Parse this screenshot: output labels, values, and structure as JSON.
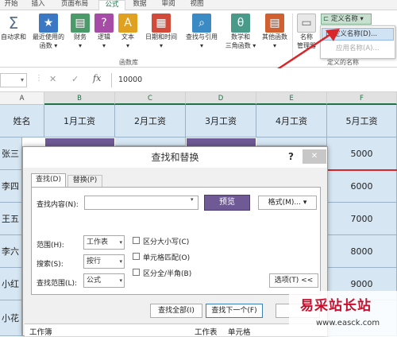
{
  "tabs": [
    "开始",
    "插入",
    "页面布局",
    "公式",
    "数据",
    "审阅",
    "视图"
  ],
  "ribbon": {
    "buttons": [
      {
        "label1": "自动求和",
        "label2": "",
        "color": "#5a6f8a",
        "glyph": "Σ"
      },
      {
        "label1": "最近使用的",
        "label2": "函数 ▾",
        "color": "#3a78c3",
        "glyph": "★"
      },
      {
        "label1": "财务",
        "label2": "▾",
        "color": "#4a9a6a",
        "glyph": "▤"
      },
      {
        "label1": "逻辑",
        "label2": "▾",
        "color": "#a64ca6",
        "glyph": "?"
      },
      {
        "label1": "文本",
        "label2": "▾",
        "color": "#e0a020",
        "glyph": "A"
      },
      {
        "label1": "日期和时间",
        "label2": "▾",
        "color": "#d24a3a",
        "glyph": "▦"
      },
      {
        "label1": "查找与引用",
        "label2": "▾",
        "color": "#3a8ac3",
        "glyph": "⌕"
      },
      {
        "label1": "数学和",
        "label2": "三角函数 ▾",
        "color": "#4a9a8a",
        "glyph": "θ"
      },
      {
        "label1": "其他函数",
        "label2": "▾",
        "color": "#d06030",
        "glyph": "▤"
      },
      {
        "label1": "名称",
        "label2": "管理器",
        "color": "#777777",
        "glyph": "▭"
      }
    ],
    "group_label": "函数库",
    "defined_names_label": "定义的名称",
    "dropdown": {
      "header": "定义名称 ▾",
      "item1": "定义名称(D)...",
      "item2": "应用名称(A)..."
    }
  },
  "formula_bar": {
    "value": "10000",
    "cancel": "✕",
    "enter": "✓",
    "fx": "fx"
  },
  "grid": {
    "columns": [
      "A",
      "B",
      "C",
      "D",
      "E",
      "F"
    ],
    "header_row": [
      "姓名",
      "1月工资",
      "2月工资",
      "3月工资",
      "4月工资",
      "5月工资"
    ],
    "names": [
      "张三",
      "李四",
      "王五",
      "李六",
      "小红",
      "小花"
    ],
    "col_f": [
      "5000",
      "6000",
      "7000",
      "8000",
      "9000",
      ""
    ]
  },
  "dialog": {
    "title": "查找和替换",
    "help": "?",
    "close": "✕",
    "tab_find": "查找(D)",
    "tab_replace": "替换(P)",
    "find_label": "查找内容(N):",
    "find_value": "",
    "preview": "预览",
    "format": "格式(M)... ▾",
    "scope_label": "范围(H):",
    "scope_value": "工作表",
    "search_label": "搜索(S):",
    "search_value": "按行",
    "lookin_label": "查找范围(L):",
    "lookin_value": "公式",
    "opt_case": "区分大小写(C)",
    "opt_cell": "单元格匹配(O)",
    "opt_width": "区分全/半角(B)",
    "options_btn": "选项(T) <<",
    "find_all": "查找全部(I)",
    "find_next": "查找下一个(F)",
    "results_cols": [
      "工作簿",
      "工作表",
      "单元格"
    ]
  },
  "watermark": {
    "text": "易采站长站",
    "url": "www.easck.com"
  },
  "colors": {
    "excel_green": "#217346",
    "cell_blue": "#d6e6f3",
    "purple": "#6f5a96",
    "arrow_red": "#d9262b"
  }
}
